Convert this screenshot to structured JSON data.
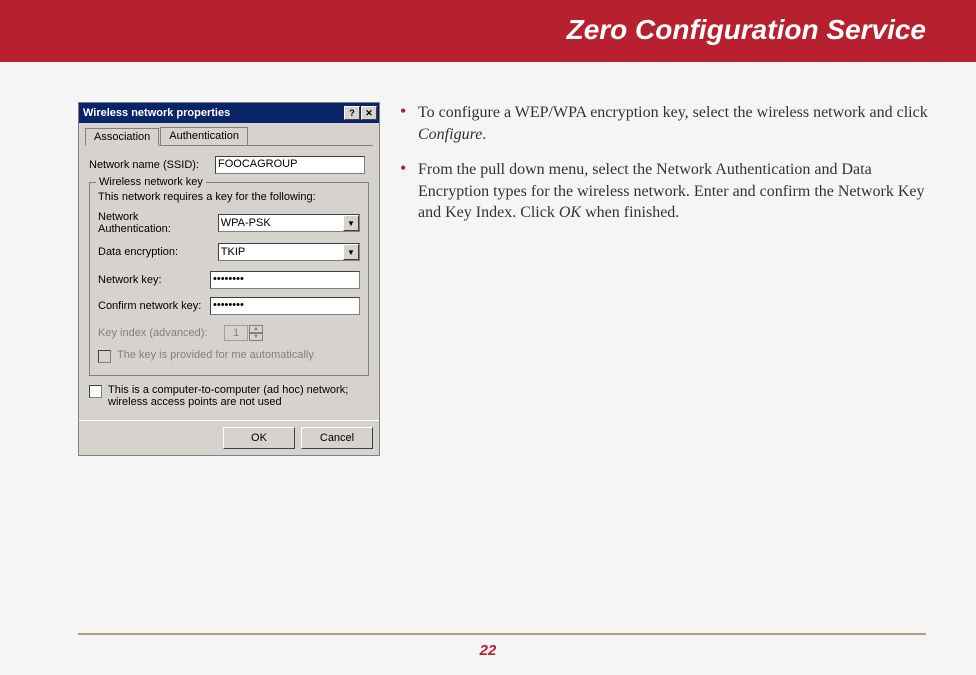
{
  "header": {
    "title": "Zero Configuration Service"
  },
  "dialog": {
    "title": "Wireless network properties",
    "help_btn": "?",
    "close_btn": "✕",
    "tabs": {
      "association": "Association",
      "authentication": "Authentication"
    },
    "ssid_label": "Network name (SSID):",
    "ssid_value": "FOOCAGROUP",
    "wnk_legend": "Wireless network key",
    "wnk_note": "This network requires a key for the following:",
    "auth_label": "Network Authentication:",
    "auth_value": "WPA-PSK",
    "enc_label": "Data encryption:",
    "enc_value": "TKIP",
    "key_label": "Network key:",
    "key_value": "••••••••",
    "confirm_label": "Confirm network key:",
    "confirm_value": "••••••••",
    "key_index_label": "Key index (advanced):",
    "key_index_value": "1",
    "auto_key_label": "The key is provided for me automatically",
    "adhoc_label": "This is a computer-to-computer (ad hoc) network; wireless access points are not used",
    "ok": "OK",
    "cancel": "Cancel"
  },
  "bullets": {
    "b1a": "To configure a WEP/WPA encryption key, select the wireless network and click ",
    "b1b": "Configure",
    "b1c": ".",
    "b2a": "From the pull down menu, select the Network Authentication and Data Encryption types for the wireless network.  Enter and confirm the Network Key and Key Index.  Click ",
    "b2b": "OK",
    "b2c": " when finished."
  },
  "page_number": "22"
}
